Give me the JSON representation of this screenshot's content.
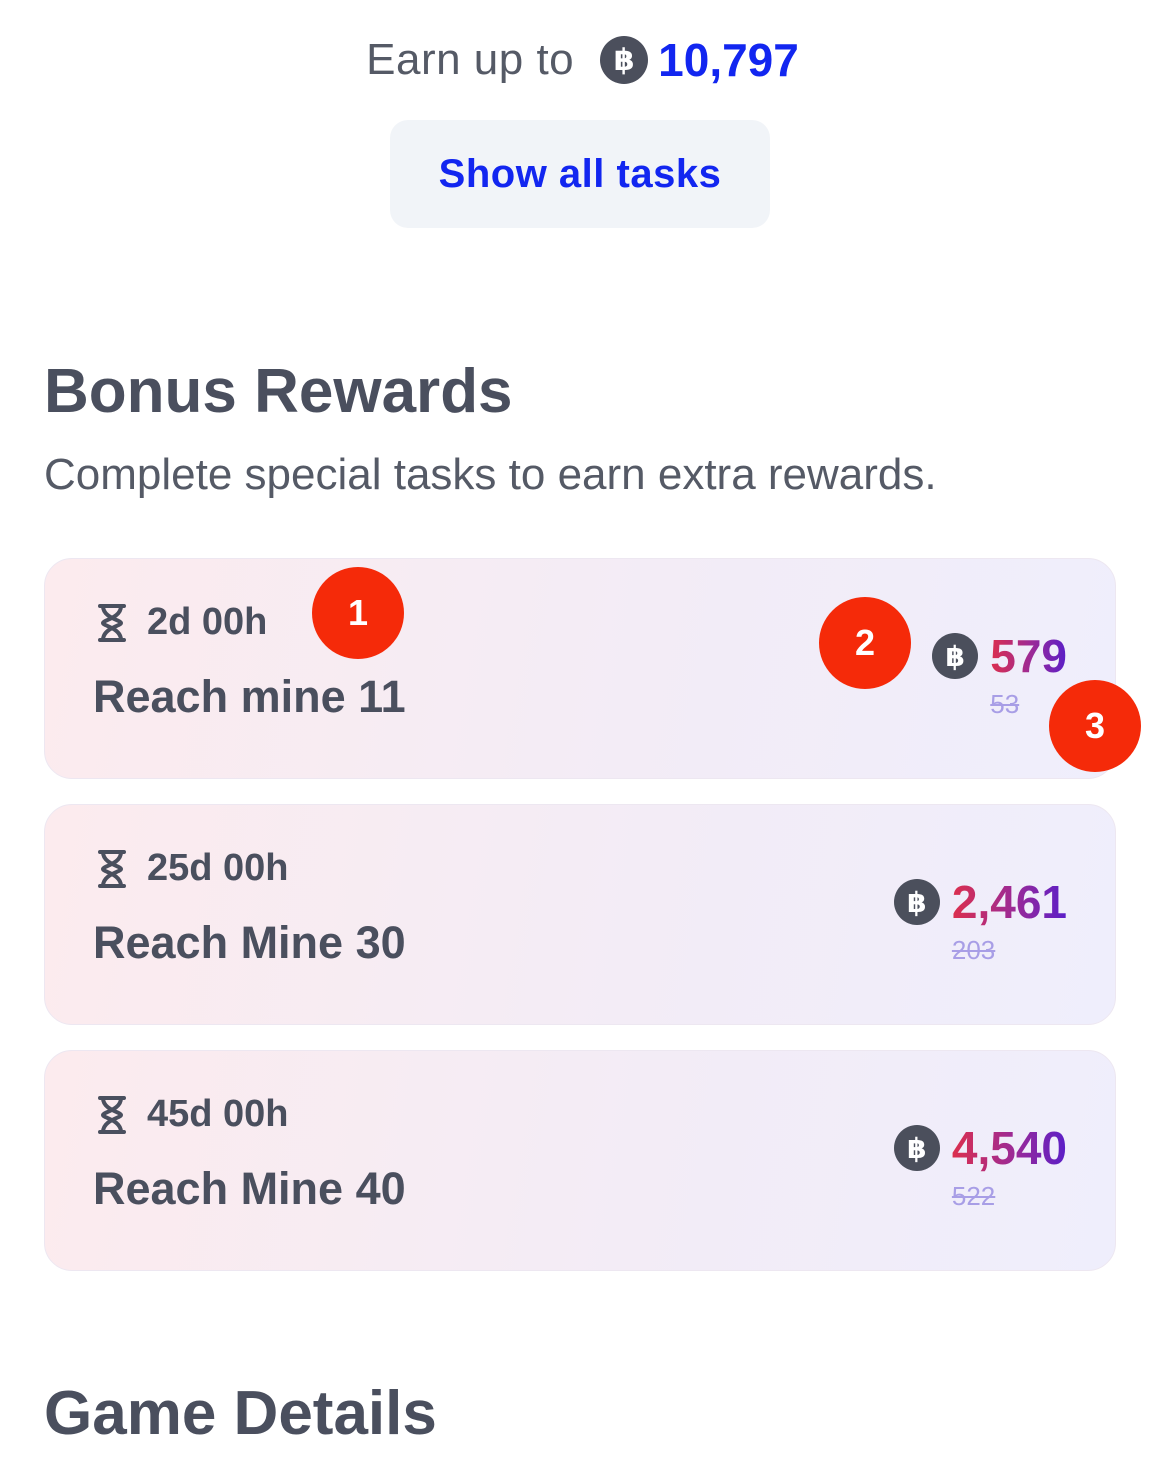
{
  "earn": {
    "label": "Earn up to",
    "coin_icon": "bitcoin-coin-icon",
    "coin_symbol": "฿",
    "value": "10,797"
  },
  "show_all_button": "Show all tasks",
  "bonus": {
    "title": "Bonus Rewards",
    "subtitle": "Complete special tasks to earn extra rewards.",
    "tasks": [
      {
        "timer": "2d 00h",
        "name": "Reach mine 11",
        "reward": "579",
        "old_reward": "53"
      },
      {
        "timer": "25d 00h",
        "name": "Reach Mine 30",
        "reward": "2,461",
        "old_reward": "203"
      },
      {
        "timer": "45d 00h",
        "name": "Reach Mine 40",
        "reward": "4,540",
        "old_reward": "522"
      }
    ]
  },
  "markers": [
    "1",
    "2",
    "3"
  ],
  "game_details": {
    "title": "Game Details"
  },
  "colors": {
    "accent_blue": "#1226f0",
    "marker_red": "#f52a09",
    "reward_gradient_start": "#dc2f4d",
    "reward_gradient_end": "#5a1ec8",
    "old_reward": "#a89ee6"
  }
}
